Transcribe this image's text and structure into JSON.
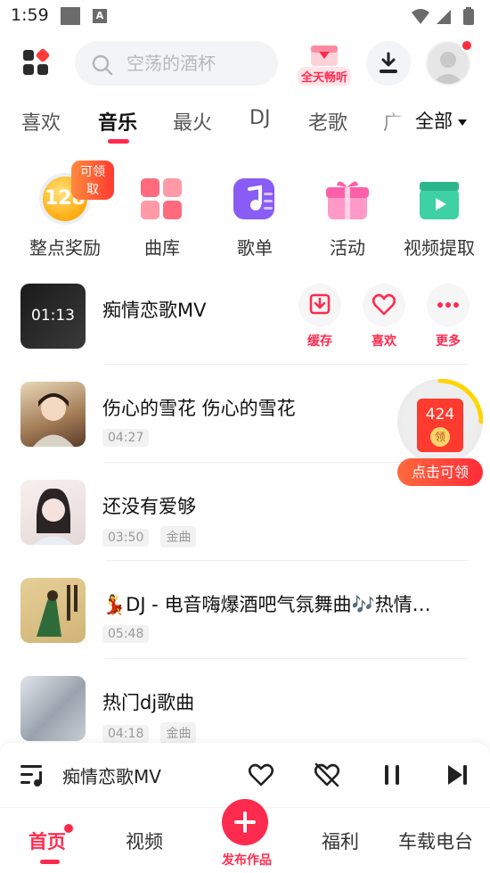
{
  "status_bar": {
    "time": "1:59",
    "notif_a": "A"
  },
  "search": {
    "placeholder": "空荡的酒杯"
  },
  "header": {
    "listen_label": "全天畅听"
  },
  "tabs": [
    {
      "label": "喜欢"
    },
    {
      "label": "音乐",
      "active": true
    },
    {
      "label": "最火"
    },
    {
      "label": "DJ"
    },
    {
      "label": "老歌"
    },
    {
      "label": "广"
    }
  ],
  "all_button": "全部",
  "quick_entries": [
    {
      "label": "整点奖励",
      "badge": "可领取",
      "value": "128"
    },
    {
      "label": "曲库"
    },
    {
      "label": "歌单"
    },
    {
      "label": "活动"
    },
    {
      "label": "视频提取"
    }
  ],
  "songs": [
    {
      "title": "痴情恋歌MV",
      "duration_overlay": "01:13",
      "actions": [
        "缓存",
        "喜欢",
        "更多"
      ]
    },
    {
      "title": "伤心的雪花 伤心的雪花",
      "duration": "04:27"
    },
    {
      "title": "还没有爱够",
      "duration": "03:50",
      "tag": "金曲"
    },
    {
      "title": "💃DJ - 电音嗨爆酒吧气氛舞曲🎶热情…",
      "duration": "05:48"
    },
    {
      "title": "热门dj歌曲",
      "duration": "04:18",
      "tag": "金曲"
    }
  ],
  "reward": {
    "amount": "424",
    "ling": "领",
    "cta": "点击可领"
  },
  "player": {
    "title": "痴情恋歌MV"
  },
  "nav": {
    "home": "首页",
    "video": "视频",
    "publish": "发布作品",
    "welfare": "福利",
    "car": "车载电台"
  },
  "colors": {
    "accent": "#ff2b4e",
    "text": "#222222"
  }
}
